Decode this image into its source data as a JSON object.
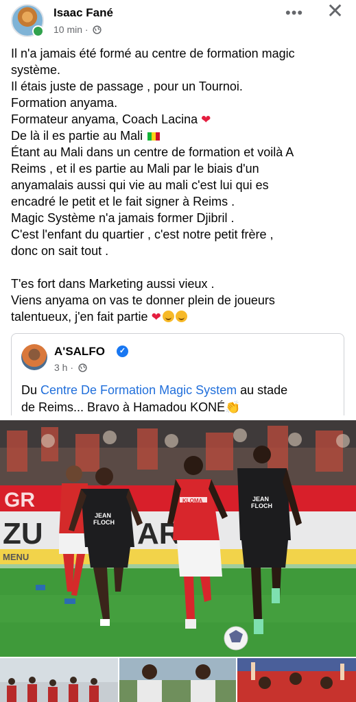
{
  "post": {
    "author": "Isaac Fané",
    "time": "10 min",
    "separator": "·",
    "more_icon": "more-horizontal-icon",
    "close_icon": "close-icon",
    "lines": [
      "Il n'a jamais été formé au centre de formation magic",
      "système.",
      "Il étais juste de passage , pour un Tournoi.",
      "Formation anyama.",
      "Formateur anyama, Coach Lacina",
      "De là il es partie au Mali",
      "Étant au Mali dans un centre de formation et voilà A",
      "Reims ,  et il es partie au Mali par le biais d'un",
      "anyamalais aussi qui vie au mali c'est lui qui es",
      "encadré le petit et le fait signer à Reims .",
      "Magic Système n'a jamais former Djibril .",
      "C'est l'enfant du quartier , c'est notre petit frère ,",
      "donc on sait tout .",
      "",
      "T'es fort dans Marketing aussi vieux .",
      "Viens anyama on vas te donner plein de joueurs",
      "talentueux, j'en fait partie"
    ]
  },
  "shared": {
    "author": "A'SALFO",
    "time": "3 h",
    "separator": "·",
    "text_before": "Du ",
    "link_text": "Centre De Formation Magic System",
    "text_after_1": " au stade",
    "text_line2": "de Reims... Bravo à Hamadou KONÉ"
  },
  "photo": {
    "banner_text_1": "GR",
    "banner_text_2": "ZU",
    "banner_text_3": "AR",
    "banner_text_4": "MENU",
    "sponsor_1": "JEAN\nFLOCH",
    "sponsor_2": "KLOMA",
    "sponsor_3": "JEAN\nFLOCH"
  },
  "colors": {
    "link": "#216fdb",
    "verified": "#1877f2",
    "online": "#31a24c",
    "heart": "#e41e3f"
  }
}
